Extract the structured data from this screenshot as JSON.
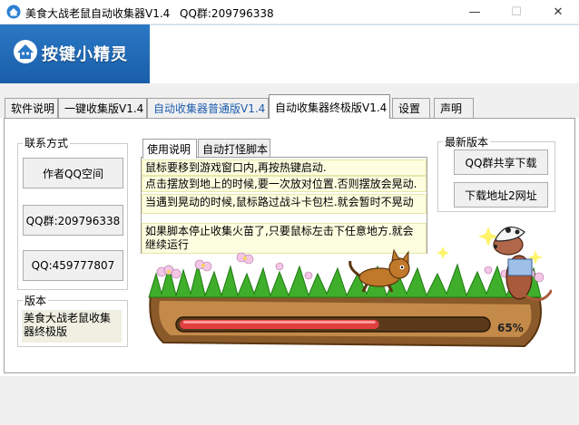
{
  "window": {
    "title": "美食大战老鼠自动收集器V1.4",
    "qq_group": "QQ群:209796338",
    "minimize_glyph": "—",
    "maximize_glyph": "☐",
    "close_glyph": "✕"
  },
  "banner": {
    "brand": "按键小精灵"
  },
  "tabs": [
    {
      "label": "软件说明"
    },
    {
      "label": "一键收集版V1.4"
    },
    {
      "label": "自动收集器普通版V1.4"
    },
    {
      "label": "自动收集器终极版V1.4"
    },
    {
      "label": "设置"
    },
    {
      "label": "声明"
    }
  ],
  "contact": {
    "title": "联系方式",
    "qq_space_button": "作者QQ空间",
    "qq_group_button": "QQ群:209796338",
    "qq_button": "QQ:459777807"
  },
  "version": {
    "title": "版本",
    "text": "美食大战老鼠收集器终极版"
  },
  "inner_tabs": [
    {
      "label": "使用说明"
    },
    {
      "label": "自动打怪脚本"
    }
  ],
  "instructions": [
    "鼠标要移到游戏窗口内,再按热键启动.",
    "点击摆放到地上的时候,要一次放对位置.否则摆放会晃动.",
    "当遇到晃动的时候,鼠标路过战斗卡包栏.就会暂时不晃动",
    "如果脚本停止收集火苗了,只要鼠标左击下任意地方.就会继续运行"
  ],
  "latest": {
    "title": "最新版本",
    "share_button": "QQ群共享下载",
    "download2_button": "下载地址2网址"
  },
  "progress": {
    "percent_label": "65%",
    "value": 0.65
  },
  "colors": {
    "banner": "#1f65b0",
    "tab_blue_text": "#1f5fb0",
    "progress_fill": "#e04040",
    "grass": "#3fae2a"
  }
}
